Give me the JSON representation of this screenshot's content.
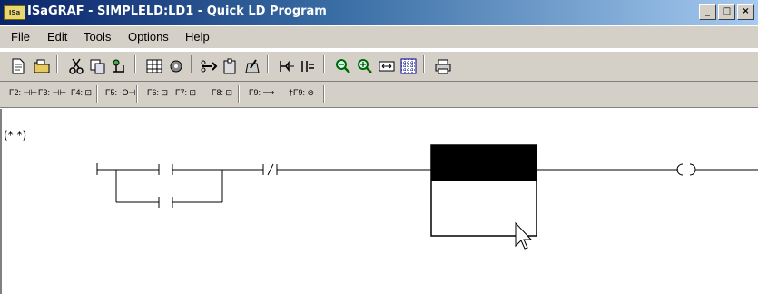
{
  "window": {
    "title": "ISaGRAF - SIMPLELD:LD1 - Quick LD Program",
    "logo_text": "ISa"
  },
  "window_controls": {
    "minimize": "_",
    "maximize": "□",
    "close": "×"
  },
  "menu": [
    "File",
    "Edit",
    "Tools",
    "Options",
    "Help"
  ],
  "toolbar_icons": [
    "new-icon",
    "open-icon",
    "cut-icon",
    "copy-icon",
    "find-icon",
    "grid-icon",
    "settings-icon",
    "scissors-icon",
    "paste-icon",
    "clear-icon",
    "jump-icon",
    "step-icon",
    "zoom-out-icon",
    "zoom-in-icon",
    "fit-icon",
    "dots-grid-icon",
    "print-icon"
  ],
  "fkeys": [
    "F2: ⊣⊢",
    "F3: ⊣⊢",
    "F4: ⊡",
    "F5: -O⊣",
    "F6: ⊡",
    "F7: ⊡",
    "F8: ⊡",
    "F9: ⟶",
    "†F9: ⊘"
  ],
  "editor": {
    "comment": "(* *)"
  },
  "colors": {
    "title_start": "#0a246a",
    "title_end": "#a6caf0",
    "chrome": "#d4d0c8",
    "selection": "#000000"
  }
}
